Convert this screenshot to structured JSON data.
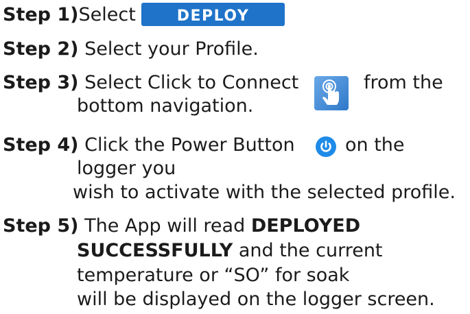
{
  "steps": [
    {
      "label": "Step 1)",
      "text": "Select",
      "button_label": "DEPLOY"
    },
    {
      "label": "Step 2)",
      "text": "Select your Profile."
    },
    {
      "label": "Step 3)",
      "text_before_icon": "Select Click to Connect",
      "text_after_icon": "from the",
      "continuation": "bottom navigation.",
      "icon": "tap-finger-icon"
    },
    {
      "label": "Step 4)",
      "text_before_icon": "Click the Power Button",
      "text_after_icon": "on the",
      "continuation_1": "logger you",
      "continuation_2": "wish to activate with the selected profile.",
      "icon": "power-icon"
    },
    {
      "label": "Step 5)",
      "text_before_bold": "The App will read",
      "bold_1": "DEPLOYED",
      "bold_2": "SUCCESSFULLY",
      "text_after_bold": "and the current",
      "continuation_1": "temperature or “SO” for soak",
      "continuation_2": "will be displayed on the logger screen."
    }
  ],
  "colors": {
    "button": "#1f73c9",
    "icon_blue": "#2f78c9",
    "text": "#1b1b1b"
  }
}
